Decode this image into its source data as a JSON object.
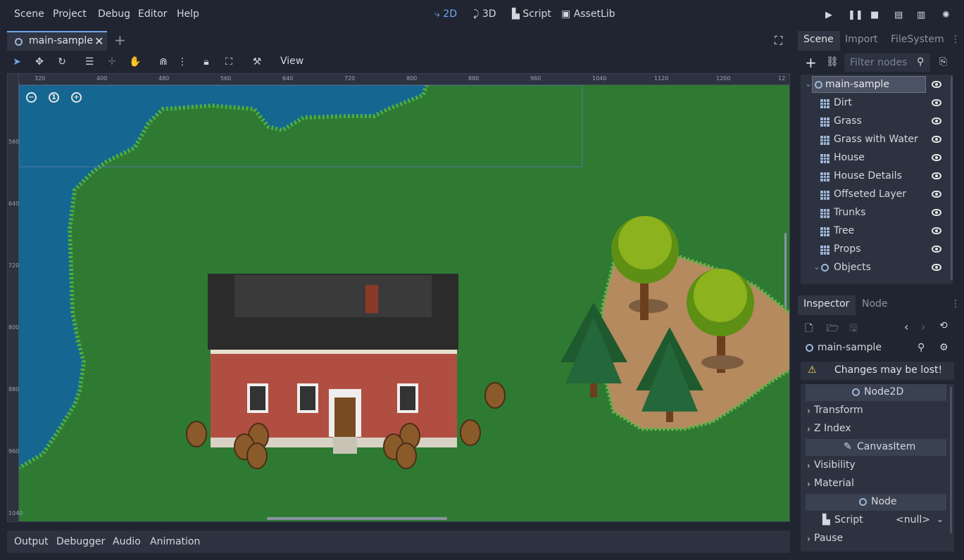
{
  "menubar": {
    "menus": [
      "Scene",
      "Project",
      "Debug",
      "Editor",
      "Help"
    ],
    "modes": [
      "2D",
      "3D",
      "Script",
      "AssetLib"
    ]
  },
  "editor": {
    "tab": "main-sample",
    "view_menu": "View",
    "ruler_x": [
      "320",
      "400",
      "480",
      "560",
      "640",
      "720",
      "800",
      "880",
      "960",
      "1040",
      "1120",
      "1200",
      "12"
    ],
    "ruler_y": [
      "560",
      "640",
      "720",
      "800",
      "880",
      "960",
      "1040"
    ],
    "zoom_level": "1"
  },
  "bottom_tabs": [
    "Output",
    "Debugger",
    "Audio",
    "Animation"
  ],
  "scene_dock": {
    "tabs": [
      "Scene",
      "Import",
      "FileSystem"
    ],
    "filter_placeholder": "Filter nodes",
    "root": "main-sample",
    "nodes": [
      "Dirt",
      "Grass",
      "Grass with Water",
      "House",
      "House Details",
      "Offseted Layer",
      "Trunks",
      "Tree",
      "Props"
    ],
    "objects": "Objects"
  },
  "inspector": {
    "tabs": [
      "Inspector",
      "Node"
    ],
    "object": "main-sample",
    "warning": "Changes may be lost!",
    "sections": {
      "node2d": "Node2D",
      "transform": "Transform",
      "zindex": "Z Index",
      "canvasitem": "CanvasItem",
      "visibility": "Visibility",
      "material": "Material",
      "node": "Node",
      "script": "Script",
      "script_value": "<null>",
      "pause": "Pause"
    }
  },
  "colors": {
    "accent": "#6fa7ea",
    "grass": "#2e7a33",
    "water": "#156690",
    "background": "#202531"
  }
}
